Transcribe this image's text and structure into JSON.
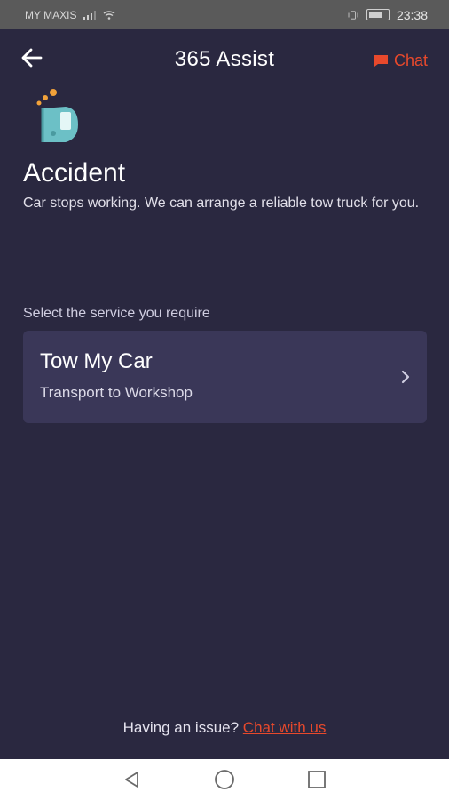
{
  "status_bar": {
    "carrier": "MY MAXIS",
    "time": "23:38"
  },
  "header": {
    "title": "365 Assist",
    "chat_label": "Chat"
  },
  "page": {
    "title": "Accident",
    "description": "Car stops working. We can arrange a reliable tow truck for you."
  },
  "services": {
    "label": "Select the service you require",
    "items": [
      {
        "title": "Tow My Car",
        "subtitle": "Transport to Workshop"
      }
    ]
  },
  "footer": {
    "question": "Having an issue?",
    "link": "Chat with us"
  },
  "colors": {
    "background": "#2a2840",
    "card": "#3a3758",
    "accent": "#e8492c",
    "icon_teal": "#6cc0c6",
    "icon_orange": "#f2a23a"
  },
  "icons": {
    "back": "arrow-left-icon",
    "chat": "chat-bubble-icon",
    "hero": "car-accident-icon",
    "chevron": "chevron-right-icon"
  }
}
